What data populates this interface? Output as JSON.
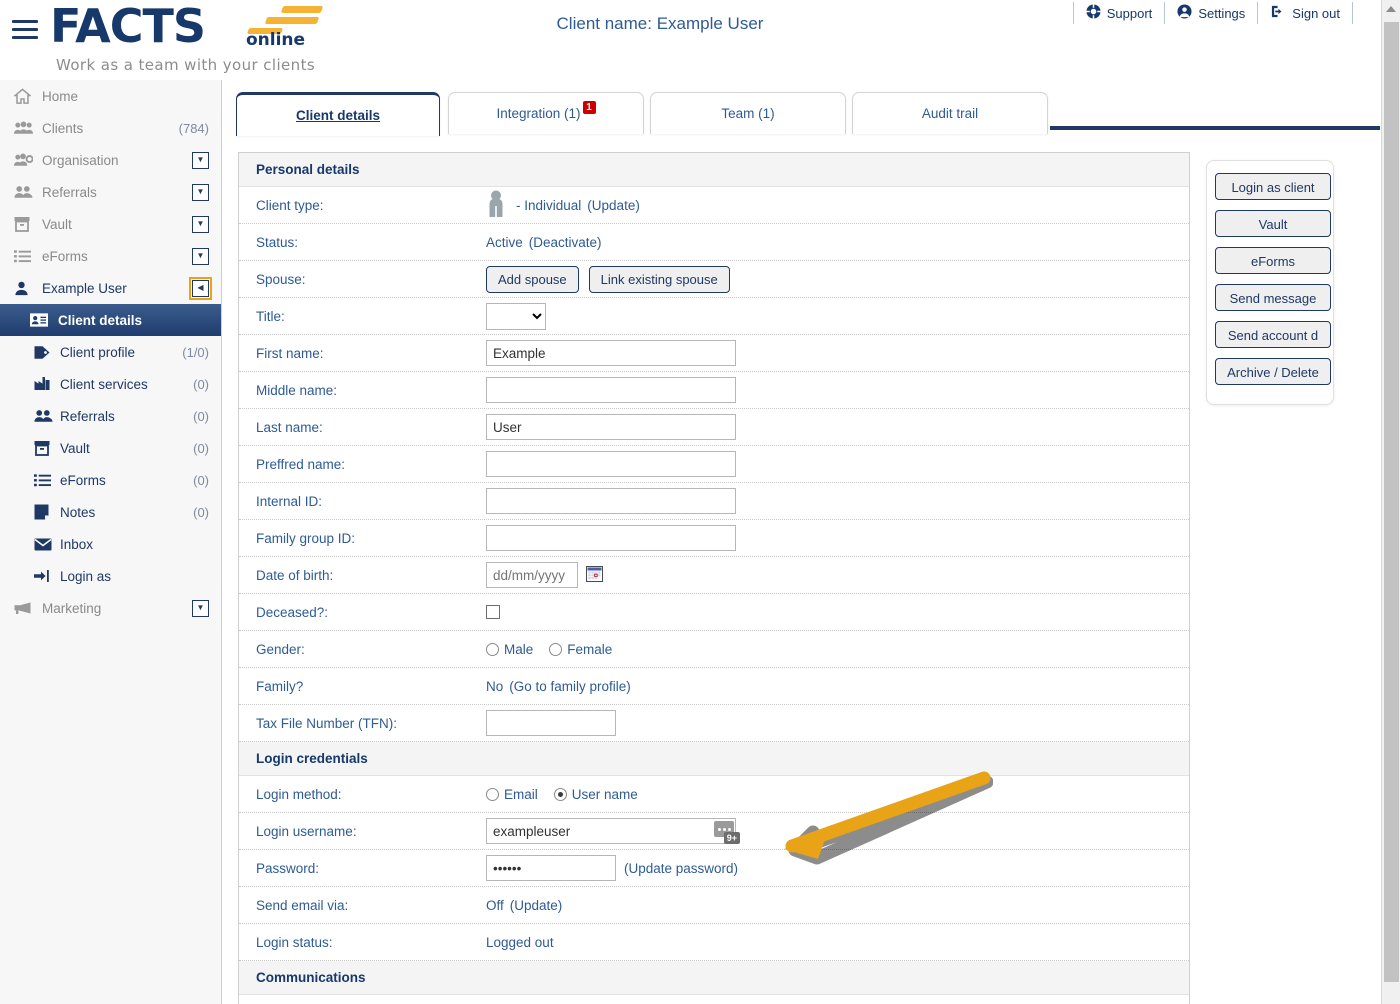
{
  "header": {
    "menu_icon": "hamburger-icon",
    "logo_main": "FACTS",
    "logo_sub": "online",
    "tagline": "Work as a team with your clients",
    "client_title": "Client name: Example User",
    "topnav": [
      {
        "label": "Support",
        "icon": "lifebuoy-icon"
      },
      {
        "label": "Settings",
        "icon": "account-circle-icon"
      },
      {
        "label": "Sign out",
        "icon": "sign-out-icon"
      }
    ]
  },
  "sidebar": {
    "items": [
      {
        "label": "Home",
        "icon": "home-icon",
        "count": "",
        "caret": false,
        "dim": true
      },
      {
        "label": "Clients",
        "icon": "clients-icon",
        "count": "(784)",
        "caret": false,
        "dim": true
      },
      {
        "label": "Organisation",
        "icon": "organisation-icon",
        "count": "",
        "caret": true,
        "dim": true
      },
      {
        "label": "Referrals",
        "icon": "referrals-icon",
        "count": "",
        "caret": true,
        "dim": true
      },
      {
        "label": "Vault",
        "icon": "vault-icon",
        "count": "",
        "caret": true,
        "dim": true
      },
      {
        "label": "eForms",
        "icon": "eforms-icon",
        "count": "",
        "caret": true,
        "dim": true
      },
      {
        "label": "Example User",
        "icon": "user-icon",
        "count": "",
        "caret": "collapse",
        "dim": false
      }
    ],
    "sub_items": [
      {
        "label": "Client details",
        "icon": "id-card-icon",
        "count": "",
        "active": true
      },
      {
        "label": "Client profile",
        "icon": "tag-icon",
        "count": "(1/0)",
        "active": false
      },
      {
        "label": "Client services",
        "icon": "client-services-icon",
        "count": "(0)",
        "active": false
      },
      {
        "label": "Referrals",
        "icon": "referrals-icon",
        "count": "(0)",
        "active": false
      },
      {
        "label": "Vault",
        "icon": "vault-icon",
        "count": "(0)",
        "active": false
      },
      {
        "label": "eForms",
        "icon": "eforms-icon",
        "count": "(0)",
        "active": false
      },
      {
        "label": "Notes",
        "icon": "notes-icon",
        "count": "(0)",
        "active": false
      },
      {
        "label": "Inbox",
        "icon": "inbox-icon",
        "count": "",
        "active": false
      },
      {
        "label": "Login as",
        "icon": "login-as-icon",
        "count": "",
        "active": false
      }
    ],
    "footer_item": {
      "label": "Marketing",
      "icon": "megaphone-icon",
      "caret": true
    }
  },
  "tabs": [
    {
      "label": "Client details",
      "badge": "",
      "active": true
    },
    {
      "label": "Integration (1)",
      "badge": "1",
      "active": false
    },
    {
      "label": "Team (1)",
      "badge": "",
      "active": false
    },
    {
      "label": "Audit trail",
      "badge": "",
      "active": false
    }
  ],
  "personal_details": {
    "heading": "Personal details",
    "client_type_label": "Client type:",
    "client_type_value": "- Individual",
    "client_type_action": "(Update)",
    "status_label": "Status:",
    "status_value": "Active",
    "status_action": "(Deactivate)",
    "spouse_label": "Spouse:",
    "spouse_add": "Add spouse",
    "spouse_link": "Link existing spouse",
    "title_label": "Title:",
    "title_value": "",
    "title_options": [
      ""
    ],
    "first_name_label": "First name:",
    "first_name_value": "Example",
    "middle_name_label": "Middle name:",
    "middle_name_value": "",
    "last_name_label": "Last name:",
    "last_name_value": "User",
    "preferred_name_label": "Preffred name:",
    "preferred_name_value": "",
    "internal_id_label": "Internal ID:",
    "internal_id_value": "",
    "family_group_label": "Family group ID:",
    "family_group_value": "",
    "dob_label": "Date of birth:",
    "dob_value": "",
    "dob_placeholder": "dd/mm/yyyy",
    "deceased_label": "Deceased?:",
    "gender_label": "Gender:",
    "gender_male": "Male",
    "gender_female": "Female",
    "family_label": "Family?",
    "family_value": "No",
    "family_action": "(Go to family profile)",
    "tfn_label": "Tax File Number (TFN):",
    "tfn_value": ""
  },
  "login_credentials": {
    "heading": "Login credentials",
    "method_label": "Login method:",
    "method_email": "Email",
    "method_username": "User name",
    "username_label": "Login username:",
    "username_value": "exampleuser",
    "pm_badge": "9+",
    "password_label": "Password:",
    "password_value": "••••••",
    "password_action": "(Update password)",
    "send_email_label": "Send email via:",
    "send_email_value": "Off",
    "send_email_action": "(Update)",
    "login_status_label": "Login status:",
    "login_status_value": "Logged out"
  },
  "communications": {
    "heading": "Communications"
  },
  "actions": {
    "buttons": [
      "Login as client",
      "Vault",
      "eForms",
      "Send message",
      "Send account d",
      "Archive / Delete"
    ]
  },
  "colors": {
    "brand_navy": "#16386b",
    "brand_gold": "#f5b335",
    "link_blue": "#2e5b94",
    "badge_red": "#cc0000",
    "annotation_arrow": "#e8a317"
  }
}
